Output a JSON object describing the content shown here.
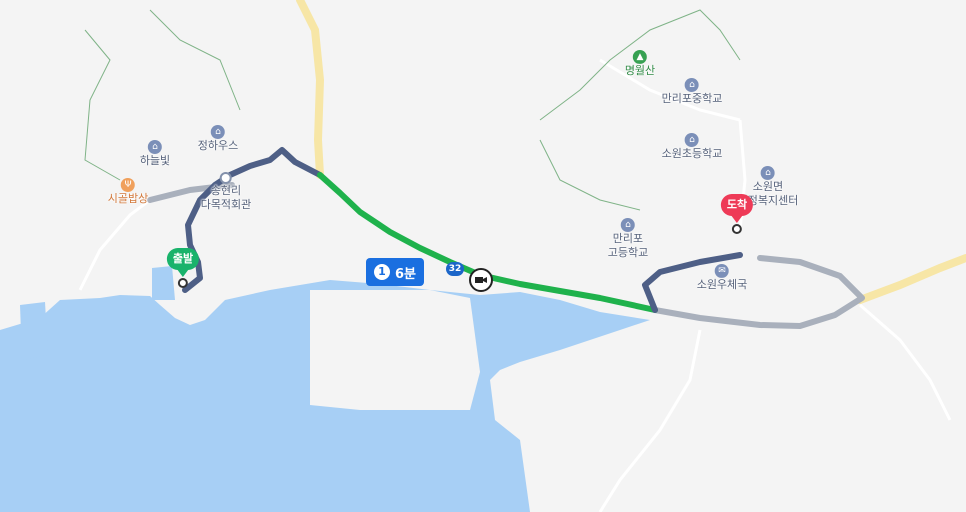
{
  "pois": {
    "hanulbit": {
      "label": "하늘빛",
      "icon": "lodging-icon"
    },
    "jeonghaus": {
      "label": "정하우스",
      "icon": "lodging-icon"
    },
    "sigolbapsang": {
      "label": "시골밥상",
      "icon": "restaurant-icon"
    },
    "songhyeon": {
      "label": "송현리\n다목적회관",
      "icon": "community-hall-icon"
    },
    "myeongwolsan": {
      "label": "명월산",
      "icon": "mountain-icon"
    },
    "manripo_middle": {
      "label": "만리포중학교",
      "icon": "school-icon"
    },
    "sowon_elem": {
      "label": "소원초등학교",
      "icon": "school-icon"
    },
    "sowon_office": {
      "label": "소원면\n행정복지센터",
      "icon": "government-office-icon"
    },
    "manripo_high": {
      "label": "만리포\n고등학교",
      "icon": "school-icon"
    },
    "sowon_post": {
      "label": "소원우체국",
      "icon": "post-office-icon"
    }
  },
  "route": {
    "start_label": "출발",
    "end_label": "도착",
    "segment_number": "1",
    "segment_time": "6분",
    "road_number": "32",
    "colors": {
      "fast": "#1fb24c",
      "slow": "#4e5f86",
      "alt": "#a9b0bc",
      "water": "#a7cff5",
      "main_road": "#f7e6a6"
    }
  },
  "icons": {
    "camera": "speed-camera-icon"
  }
}
